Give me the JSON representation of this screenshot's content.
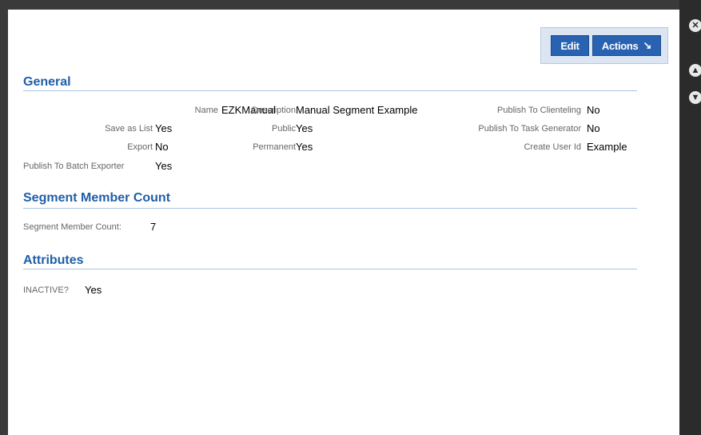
{
  "toolbar": {
    "edit_label": "Edit",
    "actions_label": "Actions",
    "actions_arrow": "↘"
  },
  "side_controls": {
    "close_icon": "close-icon",
    "up_icon": "up-arrow-icon",
    "down_icon": "down-arrow-icon"
  },
  "general": {
    "title": "General",
    "col1": [
      {
        "label": "Name",
        "value": "EZKManual"
      },
      {
        "label": "Save as List",
        "value": "Yes"
      },
      {
        "label": "Export",
        "value": "No"
      },
      {
        "label": "Publish To Batch Exporter",
        "value": "Yes"
      }
    ],
    "col2": [
      {
        "label": "Description",
        "value": "Manual Segment Example"
      },
      {
        "label": "Public",
        "value": "Yes"
      },
      {
        "label": "Permanent",
        "value": "Yes"
      }
    ],
    "col3": [
      {
        "label": "Publish To Clienteling",
        "value": "No"
      },
      {
        "label": "Publish To Task Generator",
        "value": "No"
      },
      {
        "label": "Create User Id",
        "value": "Example"
      }
    ]
  },
  "segment_count": {
    "title": "Segment Member Count",
    "label": "Segment Member Count:",
    "value": "7"
  },
  "attributes": {
    "title": "Attributes",
    "label": "INACTIVE?",
    "value": "Yes"
  }
}
